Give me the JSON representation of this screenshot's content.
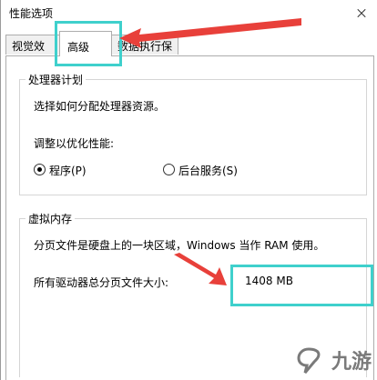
{
  "window": {
    "title": "性能选项"
  },
  "tabs": [
    {
      "label": "视觉效果"
    },
    {
      "label": "高级"
    },
    {
      "label": "数据执行保护"
    }
  ],
  "processor_group": {
    "legend": "处理器计划",
    "description": "选择如何分配处理器资源。",
    "adjust_label": "调整以优化性能:",
    "options": [
      {
        "label": "程序(P)",
        "checked": true
      },
      {
        "label": "后台服务(S)",
        "checked": false
      }
    ]
  },
  "virtual_memory_group": {
    "legend": "虚拟内存",
    "description": "分页文件是硬盘上的一块区域，Windows 当作 RAM 使用。",
    "total_label": "所有驱动器总分页文件大小:",
    "total_value": "1408 MB"
  },
  "watermark": {
    "text": "九游"
  },
  "colors": {
    "highlight": "#3fd0cc",
    "arrow": "#e8403a"
  }
}
